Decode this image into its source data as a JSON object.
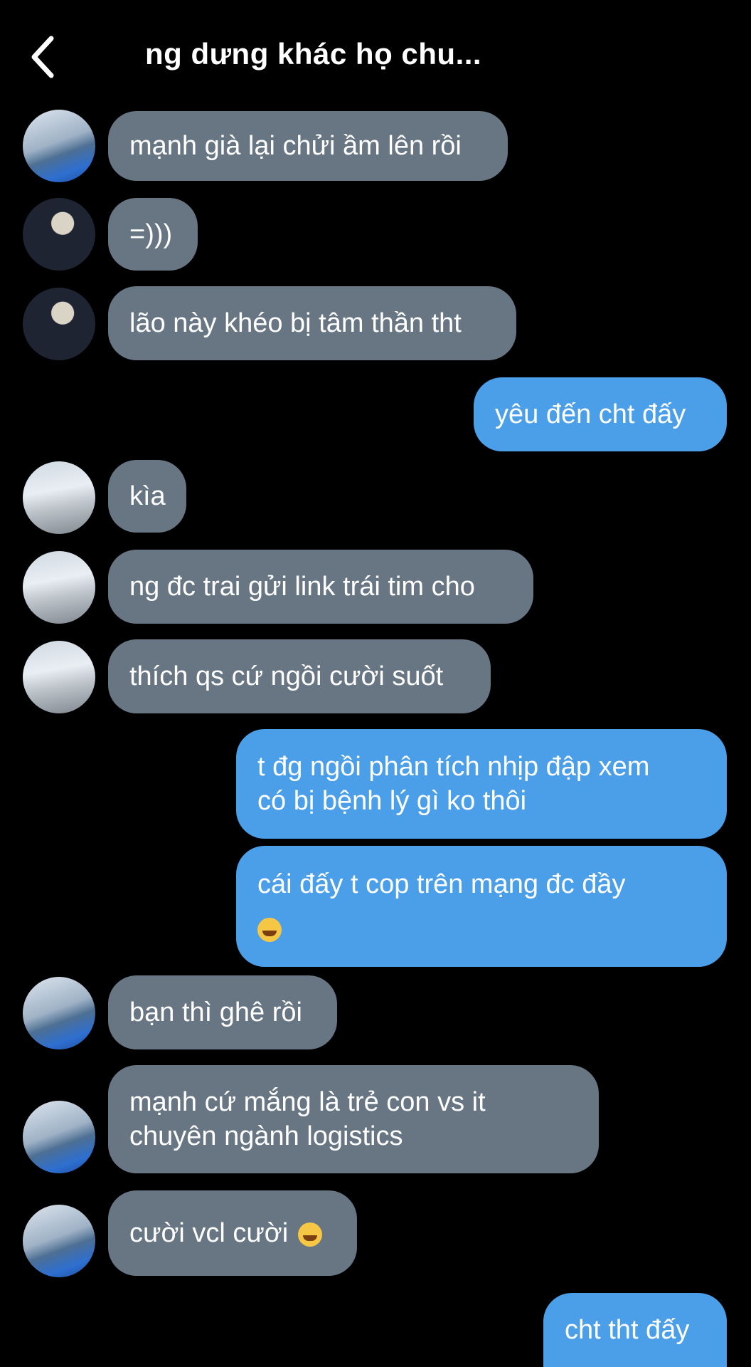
{
  "header": {
    "title": "ng dưng khác họ chu...",
    "back_icon": "chevron-left-icon"
  },
  "messages": [
    {
      "side": "in",
      "avatar": "a",
      "text": "mạnh già lại chửi ầm lên rồi"
    },
    {
      "side": "in",
      "avatar": "b",
      "text": "=)))"
    },
    {
      "side": "in",
      "avatar": "b",
      "text": "lão này khéo bị tâm thần tht"
    },
    {
      "side": "out",
      "text": "yêu đến cht đấy"
    },
    {
      "side": "in",
      "avatar": "c",
      "text": "kìa"
    },
    {
      "side": "in",
      "avatar": "c",
      "text": "ng đc trai gửi link trái tim cho"
    },
    {
      "side": "in",
      "avatar": "c",
      "text": "thích qs cứ ngồi cười suốt"
    },
    {
      "side": "out",
      "line1": "t đg ngồi phân tích nhịp đập xem",
      "line2": "có bị bệnh lý gì ko thôi"
    },
    {
      "side": "out",
      "line1": "cái đấy t cop trên mạng đc đầy",
      "emoji": "nerd-face-emoji"
    },
    {
      "side": "in",
      "avatar": "a",
      "text": "bạn thì ghê rồi"
    },
    {
      "side": "in",
      "avatar": "a",
      "line1": "mạnh cứ mắng là trẻ con vs it",
      "line2": "chuyên ngành logistics"
    },
    {
      "side": "in",
      "avatar": "a",
      "text": "cười vcl cười",
      "emoji": "laughing-face-emoji"
    },
    {
      "side": "out",
      "text": "cht tht đấy"
    }
  ]
}
